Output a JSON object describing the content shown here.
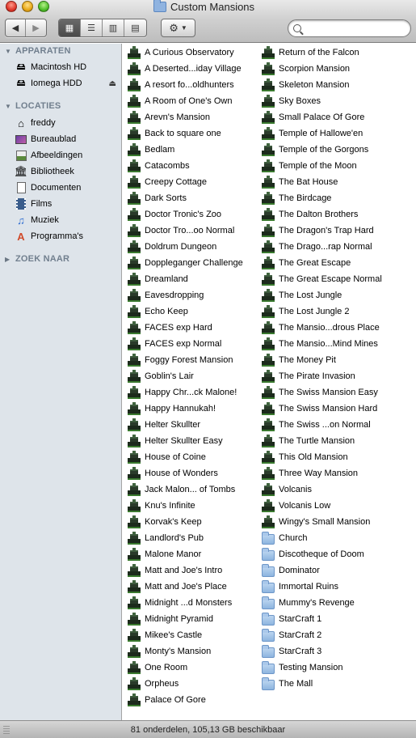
{
  "window": {
    "title": "Custom Mansions"
  },
  "toolbar": {
    "back_icon": "back-arrow-icon",
    "forward_icon": "forward-arrow-icon",
    "views": [
      "icon-view",
      "list-view",
      "column-view",
      "coverflow-view"
    ],
    "active_view": "icon-view",
    "action_icon": "gear-icon",
    "search_placeholder": ""
  },
  "sidebar": {
    "sections": [
      {
        "header": "APPARATEN",
        "expanded": true,
        "items": [
          {
            "label": "Macintosh HD",
            "icon": "hard-drive-icon"
          },
          {
            "label": "Iomega HDD",
            "icon": "external-drive-icon",
            "eject": true
          }
        ]
      },
      {
        "header": "LOCATIES",
        "expanded": true,
        "items": [
          {
            "label": "freddy",
            "icon": "home-icon"
          },
          {
            "label": "Bureaublad",
            "icon": "desktop-icon"
          },
          {
            "label": "Afbeeldingen",
            "icon": "pictures-icon"
          },
          {
            "label": "Bibliotheek",
            "icon": "library-icon"
          },
          {
            "label": "Documenten",
            "icon": "documents-icon"
          },
          {
            "label": "Films",
            "icon": "movies-icon"
          },
          {
            "label": "Muziek",
            "icon": "music-icon"
          },
          {
            "label": "Programma's",
            "icon": "applications-icon"
          }
        ]
      },
      {
        "header": "ZOEK NAAR",
        "expanded": false,
        "items": []
      }
    ]
  },
  "files": {
    "column1": [
      "A Curious Observatory",
      "A Deserted...iday Village",
      "A resort fo...oldhunters",
      "A Room of One's Own",
      "Arevn's Mansion",
      "Back to square one",
      "Bedlam",
      "Catacombs",
      "Creepy Cottage",
      "Dark Sorts",
      "Doctor Tronic's Zoo",
      "Doctor Tro...oo Normal",
      "Doldrum Dungeon",
      "Doppleganger Challenge",
      "Dreamland",
      "Eavesdropping",
      "Echo Keep",
      "FACES exp Hard",
      "FACES exp Normal",
      "Foggy Forest Mansion",
      "Goblin's Lair",
      "Happy Chr...ck Malone!",
      "Happy Hannukah!",
      "Helter Skullter",
      "Helter Skullter Easy",
      "House of Coine",
      "House of Wonders",
      "Jack Malon... of Tombs",
      "Knu's Infinite",
      "Korvak's Keep",
      "Landlord's Pub",
      "Malone Manor",
      "Matt and Joe's Intro",
      "Matt and Joe's Place",
      "Midnight ...d Monsters",
      "Midnight Pyramid",
      "Mikee's Castle",
      "Monty's Mansion",
      "One Room",
      "Orpheus",
      "Palace Of Gore"
    ],
    "column2_games": [
      "Return of the Falcon",
      "Scorpion Mansion",
      "Skeleton Mansion",
      "Sky Boxes",
      "Small Palace Of Gore",
      "Temple of Hallowe'en",
      "Temple of the Gorgons",
      "Temple of the Moon",
      "The Bat House",
      "The Birdcage",
      "The Dalton Brothers",
      "The Dragon's Trap Hard",
      "The Drago...rap Normal",
      "The Great Escape",
      "The Great Escape Normal",
      "The Lost Jungle",
      "The Lost Jungle 2",
      "The Mansio...drous Place",
      "The Mansio...Mind Mines",
      "The Money Pit",
      "The Pirate Invasion",
      "The Swiss Mansion Easy",
      "The Swiss Mansion Hard",
      "The Swiss ...on Normal",
      "The Turtle Mansion",
      "This Old Mansion",
      "Three Way Mansion",
      "Volcanis",
      "Volcanis Low",
      "Wingy's Small Mansion"
    ],
    "column2_folders": [
      "Church",
      "Discotheque of Doom",
      "Dominator",
      "Immortal Ruins",
      "Mummy's Revenge",
      "StarCraft 1",
      "StarCraft 2",
      "StarCraft 3",
      "Testing Mansion",
      "The Mall"
    ]
  },
  "status": {
    "text": "81 onderdelen, 105,13 GB beschikbaar"
  }
}
